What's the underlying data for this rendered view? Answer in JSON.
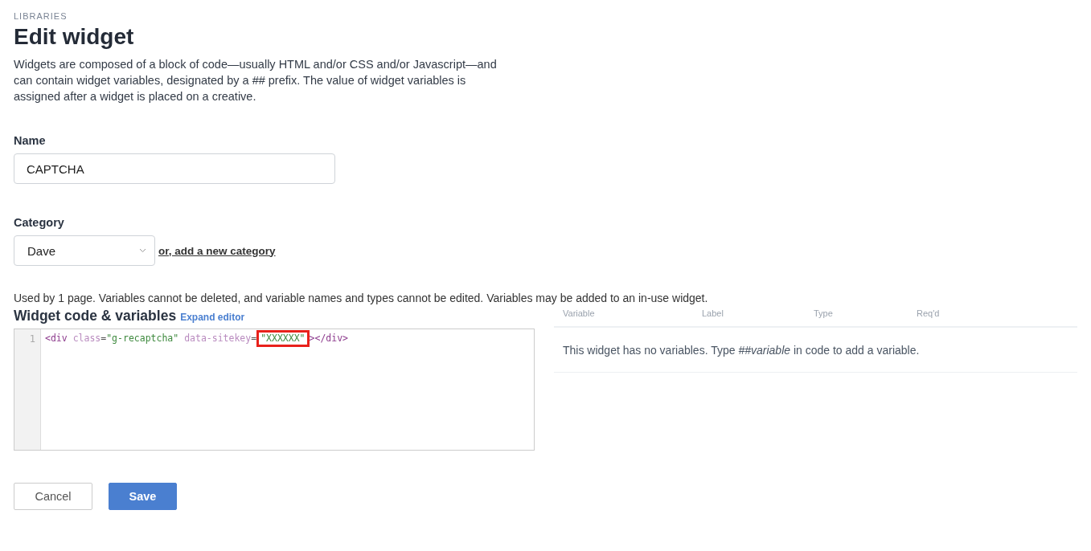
{
  "breadcrumb": "LIBRARIES",
  "title": "Edit widget",
  "intro": "Widgets are composed of a block of code—usually HTML and/or CSS and/or Javascript—and can contain widget variables, designated by a ## prefix. The value of widget variables is assigned after a widget is placed on a creative.",
  "name_field": {
    "label": "Name",
    "value": "CAPTCHA"
  },
  "category_field": {
    "label": "Category",
    "value": "Dave",
    "link": "or, add a new category"
  },
  "usage_note": "Used by 1 page. Variables cannot be deleted, and variable names and types cannot be edited. Variables may be added to an in-use widget.",
  "code_section": {
    "heading": "Widget code & variables",
    "expand_link": "Expand editor"
  },
  "editor": {
    "lines": [
      {
        "number": "1",
        "tokens": [
          {
            "kind": "tag",
            "text": "<div",
            "highlighted": false
          },
          {
            "kind": "attr",
            "text": " class",
            "highlighted": false
          },
          {
            "kind": "punct",
            "text": "=",
            "highlighted": false
          },
          {
            "kind": "string",
            "text": "\"g-recaptcha\"",
            "highlighted": false
          },
          {
            "kind": "attr",
            "text": " data-sitekey",
            "highlighted": false
          },
          {
            "kind": "punct",
            "text": "=",
            "highlighted": false
          },
          {
            "kind": "string",
            "text": "\"XXXXXX\"",
            "highlighted": true
          },
          {
            "kind": "tag",
            "text": "></div>",
            "highlighted": false
          }
        ]
      }
    ]
  },
  "variables_table": {
    "columns": [
      "Variable",
      "Label",
      "Type",
      "Req'd"
    ],
    "empty_message": "This widget has no variables. Type *##variable* in code to add a variable."
  },
  "buttons": [
    {
      "label": "Cancel",
      "kind": "secondary"
    },
    {
      "label": "Save",
      "kind": "primary"
    }
  ]
}
